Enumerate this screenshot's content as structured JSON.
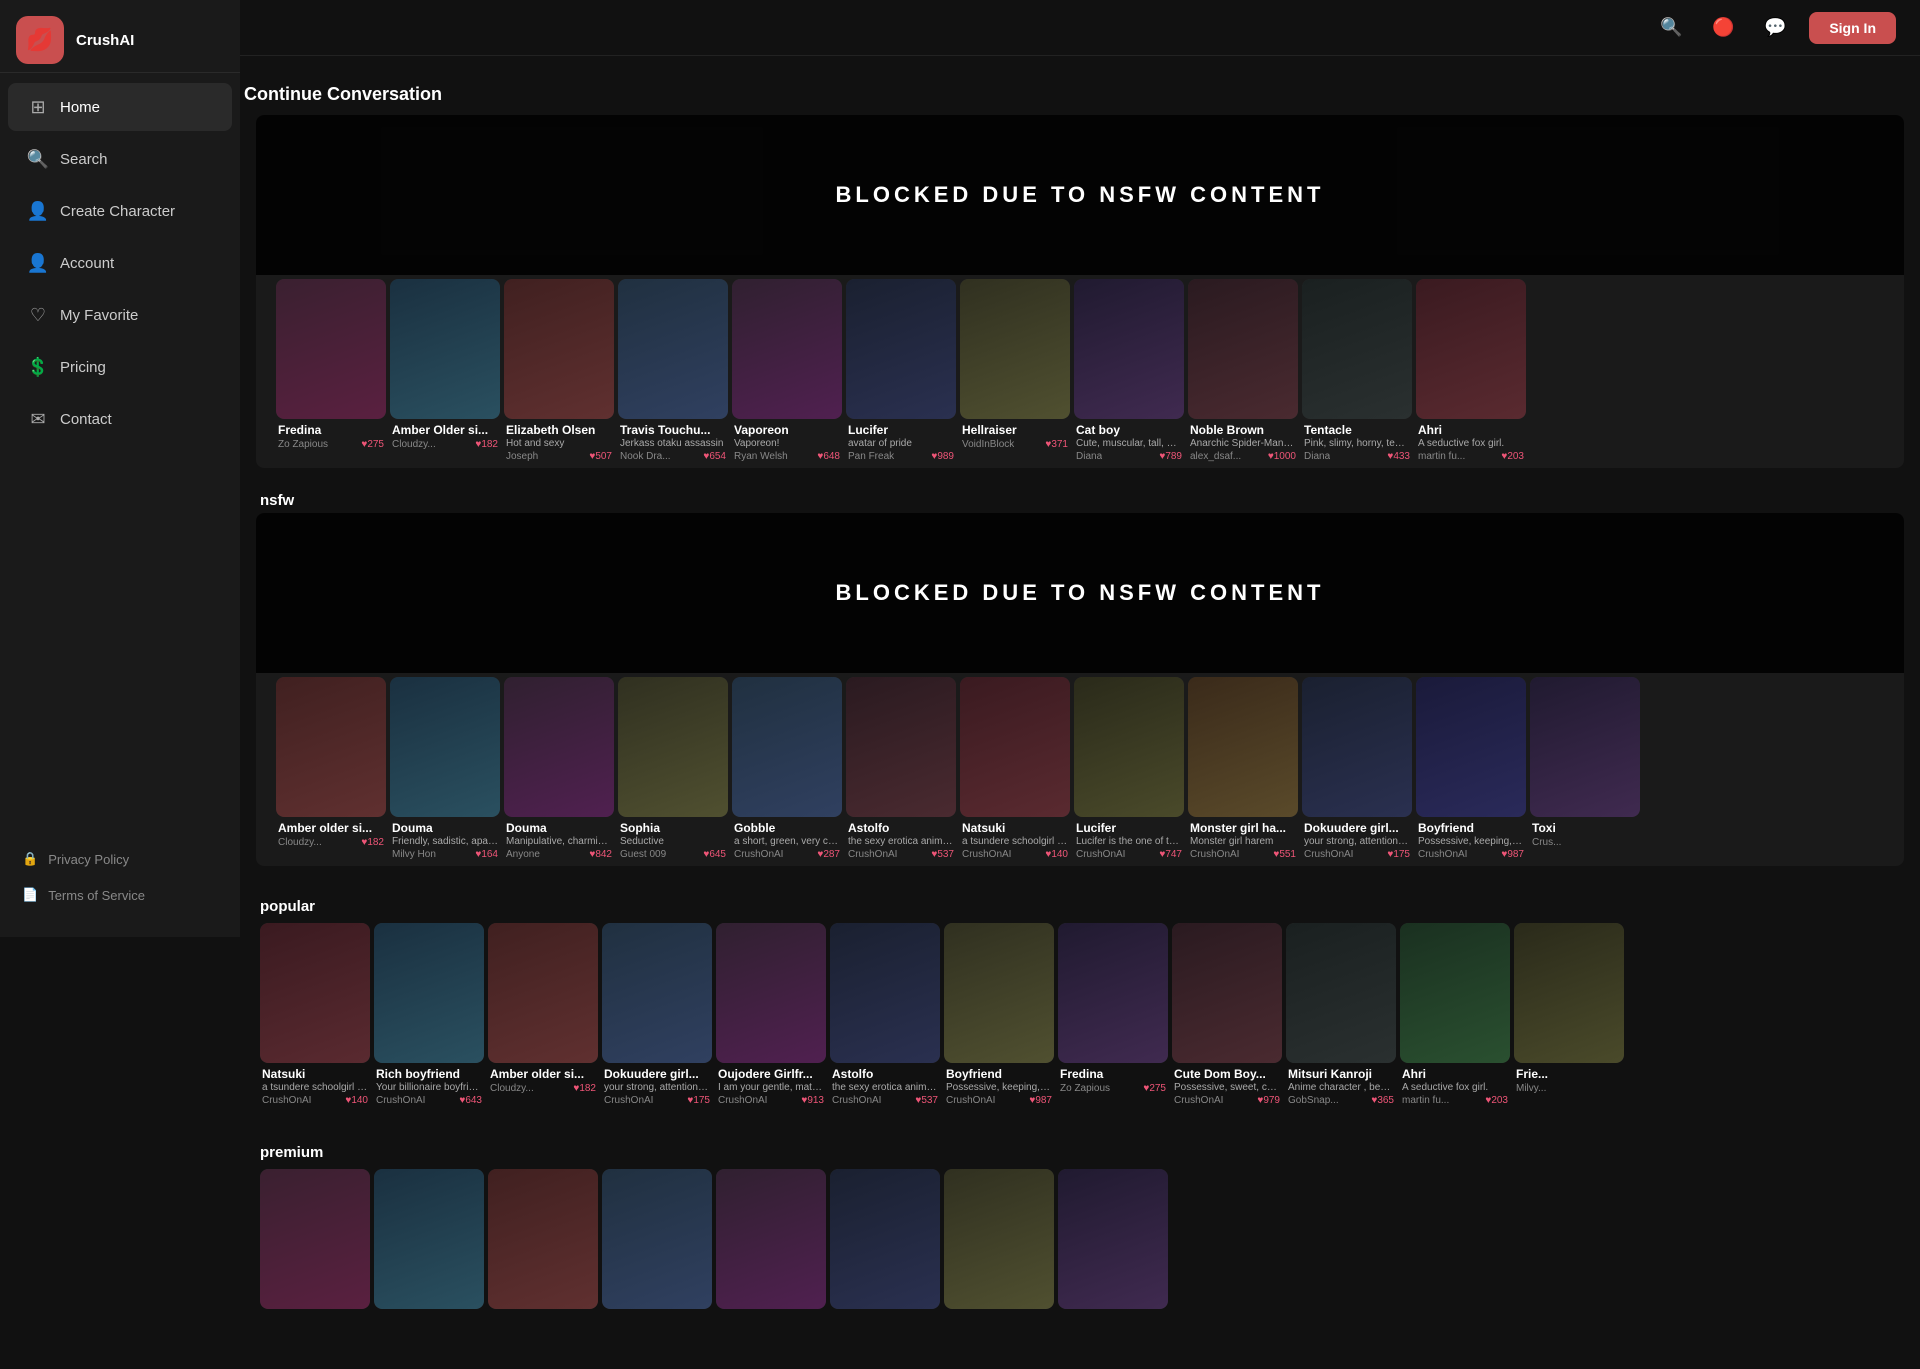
{
  "sidebar": {
    "logo": {
      "icon": "💋",
      "text": "CrushAI"
    },
    "nav_items": [
      {
        "id": "home",
        "label": "Home",
        "icon": "⊞",
        "active": true
      },
      {
        "id": "search",
        "label": "Search",
        "icon": "🔍"
      },
      {
        "id": "create",
        "label": "Create Character",
        "icon": "👤"
      },
      {
        "id": "account",
        "label": "Account",
        "icon": "👤"
      },
      {
        "id": "myfavorite",
        "label": "My Favorite",
        "icon": "♡"
      },
      {
        "id": "pricing",
        "label": "Pricing",
        "icon": "💲"
      },
      {
        "id": "contact",
        "label": "Contact",
        "icon": "✉"
      }
    ],
    "bottom_items": [
      {
        "id": "privacy",
        "label": "Privacy Policy",
        "icon": "🔒"
      },
      {
        "id": "terms",
        "label": "Terms of Service",
        "icon": "📄"
      }
    ]
  },
  "header": {
    "sign_in_label": "Sign In"
  },
  "sections": {
    "continue_conversation": {
      "title": "Continue Conversation",
      "blocked_text": "BLOCKED  DUE  TO  NSFW  CONTENT",
      "characters": [
        {
          "name": "Fredina",
          "desc": "",
          "author": "Zo Zapious",
          "likes": "275",
          "color": "c1"
        },
        {
          "name": "Amber Older si...",
          "desc": "",
          "author": "Cloudzy...",
          "likes": "182",
          "color": "c2"
        },
        {
          "name": "Elizabeth Olsen",
          "desc": "Hot and sexy",
          "author": "Joseph",
          "likes": "507",
          "color": "c3"
        },
        {
          "name": "Travis Touchu...",
          "desc": "Jerkass otaku assassin",
          "author": "Nook Dra...",
          "likes": "654",
          "color": "c4"
        },
        {
          "name": "Vaporeon",
          "desc": "Vaporeon!",
          "author": "Ryan Welsh",
          "likes": "648",
          "color": "c5"
        },
        {
          "name": "Lucifer",
          "desc": "avatar of pride",
          "author": "Pan Freak",
          "likes": "989",
          "color": "c6"
        },
        {
          "name": "Hellraiser",
          "desc": "",
          "author": "VoidInBlock",
          "likes": "371",
          "color": "c7"
        },
        {
          "name": "Cat boy",
          "desc": "Cute, muscular, tall, horny, loving cat",
          "author": "Diana",
          "likes": "789",
          "color": "c8"
        },
        {
          "name": "Noble Brown",
          "desc": "Anarchic Spider-Man, Punk-Rock",
          "author": "alex_dsaf...",
          "likes": "1000",
          "color": "c9"
        },
        {
          "name": "Tentacle",
          "desc": "Pink, slimy, horny, tentacle",
          "author": "Diana",
          "likes": "433",
          "color": "c10"
        },
        {
          "name": "Ahri",
          "desc": "A seductive fox girl.",
          "author": "martin fu...",
          "likes": "203",
          "color": "c11"
        }
      ]
    },
    "nsfw": {
      "title": "nsfw",
      "characters": [
        {
          "name": "Amber older si...",
          "desc": "",
          "author": "Cloudzy...",
          "likes": "182",
          "color": "c3"
        },
        {
          "name": "Douma",
          "desc": "Friendly, sadistic, apathetic,",
          "author": "Milvy Hon",
          "likes": "164",
          "color": "c2"
        },
        {
          "name": "Douma",
          "desc": "Manipulative, charming, overly",
          "author": "Anyone",
          "likes": "842",
          "color": "c5"
        },
        {
          "name": "Sophia",
          "desc": "Seductive",
          "author": "Guest 009",
          "likes": "645",
          "color": "c7"
        },
        {
          "name": "Gobble",
          "desc": "a short, green, very cute, goblin girl",
          "author": "CrushOnAI",
          "likes": "287",
          "color": "c4"
        },
        {
          "name": "Astolfo",
          "desc": "the sexy erotica anime femboy",
          "author": "CrushOnAI",
          "likes": "537",
          "color": "c9"
        },
        {
          "name": "Natsuki",
          "desc": "a tsundere schoolgirl from Doki",
          "author": "CrushOnAI",
          "likes": "140",
          "color": "c11"
        },
        {
          "name": "Lucifer",
          "desc": "Lucifer is the one of the main characters",
          "author": "CrushOnAI",
          "likes": "747",
          "color": "c13"
        },
        {
          "name": "Monster girl ha...",
          "desc": "Monster girl harem",
          "author": "CrushOnAI",
          "likes": "551",
          "color": "c14"
        },
        {
          "name": "Dokuudere girl...",
          "desc": "your strong, attention seeking",
          "author": "CrushOnAI",
          "likes": "175",
          "color": "c6"
        },
        {
          "name": "Boyfriend",
          "desc": "Possessive, keeping, loving,",
          "author": "CrushOnAI",
          "likes": "987",
          "color": "c15"
        },
        {
          "name": "Toxi",
          "desc": "",
          "author": "Crus...",
          "likes": "",
          "color": "c8"
        }
      ]
    },
    "popular": {
      "title": "popular",
      "characters": [
        {
          "name": "Natsuki",
          "desc": "a tsundere schoolgirl from Doki",
          "author": "CrushOnAI",
          "likes": "140",
          "color": "c11"
        },
        {
          "name": "Rich boyfriend",
          "desc": "Your billionaire boyfriend.",
          "author": "CrushOnAI",
          "likes": "643",
          "color": "c2"
        },
        {
          "name": "Amber older si...",
          "desc": "",
          "author": "Cloudzy...",
          "likes": "182",
          "color": "c3"
        },
        {
          "name": "Dokuudere girl...",
          "desc": "your strong, attention seeking",
          "author": "CrushOnAI",
          "likes": "175",
          "color": "c4"
        },
        {
          "name": "Oujodere Girlfr...",
          "desc": "I am your gentle, matured and a bit",
          "author": "CrushOnAI",
          "likes": "913",
          "color": "c5"
        },
        {
          "name": "Astolfo",
          "desc": "the sexy erotica anime femboy",
          "author": "CrushOnAI",
          "likes": "537",
          "color": "c6"
        },
        {
          "name": "Boyfriend",
          "desc": "Possessive, keeping, loving,",
          "author": "CrushOnAI",
          "likes": "987",
          "color": "c7"
        },
        {
          "name": "Fredina",
          "desc": "",
          "author": "Zo Zapious",
          "likes": "275",
          "color": "c8"
        },
        {
          "name": "Cute Dom Boy...",
          "desc": "Possessive, sweet, caring, cute, really",
          "author": "CrushOnAI",
          "likes": "979",
          "color": "c9"
        },
        {
          "name": "Mitsuri Kanroji",
          "desc": "Anime character , beautiful",
          "author": "GobSnap...",
          "likes": "365",
          "color": "c10"
        },
        {
          "name": "Ahri",
          "desc": "A seductive fox girl.",
          "author": "martin fu...",
          "likes": "203",
          "color": "c12"
        },
        {
          "name": "Frie...",
          "desc": "",
          "author": "Milvy...",
          "likes": "",
          "color": "c13"
        }
      ]
    },
    "premium": {
      "title": "premium",
      "characters": [
        {
          "name": "",
          "desc": "",
          "author": "",
          "likes": "",
          "color": "c1"
        },
        {
          "name": "",
          "desc": "",
          "author": "",
          "likes": "",
          "color": "c2"
        },
        {
          "name": "",
          "desc": "",
          "author": "",
          "likes": "",
          "color": "c3"
        },
        {
          "name": "",
          "desc": "",
          "author": "",
          "likes": "",
          "color": "c4"
        },
        {
          "name": "",
          "desc": "",
          "author": "",
          "likes": "",
          "color": "c5"
        },
        {
          "name": "",
          "desc": "",
          "author": "",
          "likes": "",
          "color": "c6"
        },
        {
          "name": "",
          "desc": "",
          "author": "",
          "likes": "",
          "color": "c7"
        },
        {
          "name": "",
          "desc": "",
          "author": "",
          "likes": "",
          "color": "c8"
        }
      ]
    }
  }
}
